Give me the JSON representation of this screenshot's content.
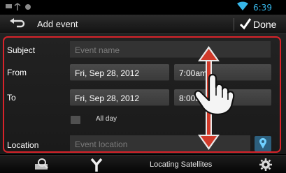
{
  "status_bar": {
    "time": "6:39",
    "left_icons": [
      "usb-icon",
      "debug-icon",
      "android-icon"
    ],
    "wifi": "wifi-icon"
  },
  "action_bar": {
    "title": "Add event",
    "done_label": "Done"
  },
  "form": {
    "subject": {
      "label": "Subject",
      "placeholder": "Event name"
    },
    "from": {
      "label": "From",
      "date": "Fri, Sep 28, 2012",
      "time": "7:00am"
    },
    "to": {
      "label": "To",
      "date": "Fri, Sep 28, 2012",
      "time": "8:00am"
    },
    "all_day": {
      "label": "All day",
      "checked": false
    },
    "location": {
      "label": "Location",
      "placeholder": "Event location"
    }
  },
  "bottom_bar": {
    "status": "Locating Satellites"
  },
  "colors": {
    "accent": "#37b6e8",
    "highlight_frame": "#d8232a",
    "arrow": "#d03a2a"
  }
}
